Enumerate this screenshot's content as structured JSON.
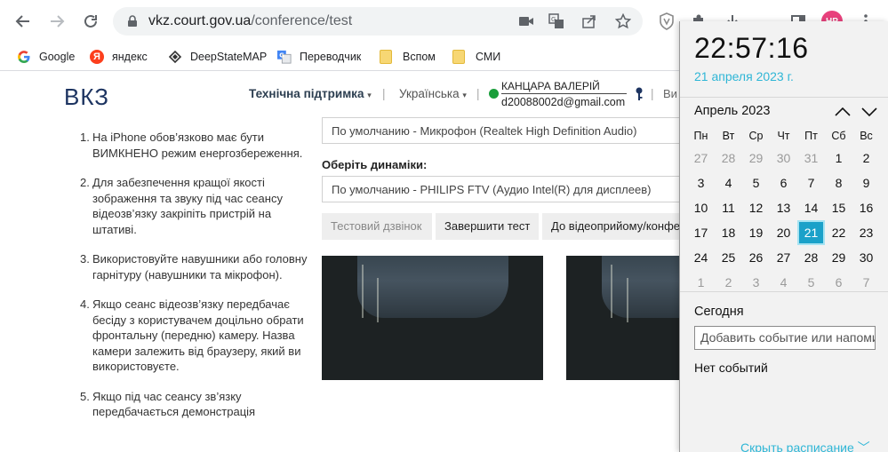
{
  "browser": {
    "url_host": "vkz.court.gov.ua",
    "url_path": "/conference/test",
    "avatar_initials": "НР",
    "colors": {
      "toolbar_bg": "#ffffff",
      "omnibox_bg": "#f1f3f4"
    }
  },
  "bookmarks": [
    {
      "label": "Google",
      "icon": "google-icon"
    },
    {
      "label": "яндекс",
      "icon": "yandex-icon",
      "glyph": "Я"
    },
    {
      "label": "DeepStateMAP",
      "icon": "deepstate-icon"
    },
    {
      "label": "Переводчик",
      "icon": "translate-icon"
    },
    {
      "label": "Вспом",
      "icon": "folder-icon"
    },
    {
      "label": "СМИ",
      "icon": "folder-icon"
    }
  ],
  "site": {
    "logo": "ВКЗ",
    "support_menu": "Технічна підтримка",
    "language_menu": "Українська",
    "user_name": "КАНЦАРА ВАЛЕРІЙ",
    "user_email": "d20088002d@gmail.com",
    "more_menu": "Ви",
    "colors": {
      "logo": "#1d3461",
      "online": "#1a9e3b"
    }
  },
  "instructions": [
    {
      "num": "1.",
      "text": "На iPhone обов’язково має бути ВИМКНЕНО режим енергозбереження."
    },
    {
      "num": "2.",
      "text": "Для забезпечення кращої якості зображення та звуку під час сеансу відеозв’язку закріпіть пристрій на штативі."
    },
    {
      "num": "3.",
      "text": "Використовуйте навушники або головну гарнітуру (навушники та мікрофон)."
    },
    {
      "num": "4.",
      "text": "Якщо сеанс відеозв’язку передбачає бесіду з користувачем доцільно обрати фронтальну (передню) камеру. Назва камери залежить від браузеру, який ви використовуєте."
    },
    {
      "num": "5.",
      "text": "Якщо під час сеансу зв’язку передбачається демонстрація"
    }
  ],
  "devices": {
    "microphone_value": "По умолчанию - Микрофон (Realtek High Definition Audio)",
    "speakers_label": "Оберіть динаміки:",
    "speakers_value": "По умолчанию - PHILIPS FTV (Аудио Intel(R) для дисплеев)"
  },
  "buttons": {
    "test_call": "Тестовий дзвінок",
    "end_test": "Завершити тест",
    "to_reception": "До відеоприйому/конференції"
  },
  "calendar": {
    "time": "22:57:16",
    "date": "21 апреля 2023 г.",
    "month_title": "Апрель 2023",
    "weekdays": [
      "Пн",
      "Вт",
      "Ср",
      "Чт",
      "Пт",
      "Сб",
      "Вс"
    ],
    "weeks": [
      [
        27,
        28,
        29,
        30,
        31,
        1,
        2
      ],
      [
        3,
        4,
        5,
        6,
        7,
        8,
        9
      ],
      [
        10,
        11,
        12,
        13,
        14,
        15,
        16
      ],
      [
        17,
        18,
        19,
        20,
        21,
        22,
        23
      ],
      [
        24,
        25,
        26,
        27,
        28,
        29,
        30
      ],
      [
        1,
        2,
        3,
        4,
        5,
        6,
        7
      ]
    ],
    "selected_day": 21,
    "today_label": "Сегодня",
    "add_event_placeholder": "Добавить событие или напоминание",
    "no_events": "Нет событий",
    "hide_schedule": "Скрыть расписание",
    "colors": {
      "accent": "#1ba1c9",
      "date_text": "#2fb6d6",
      "flyout_bg": "#f2f2f2"
    }
  }
}
